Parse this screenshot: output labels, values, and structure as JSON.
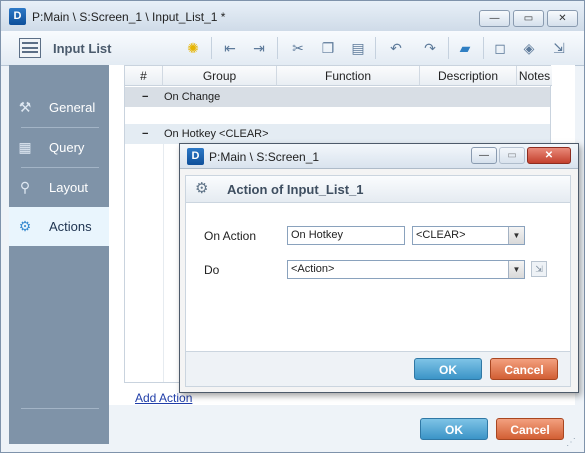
{
  "window": {
    "title": "P:Main \\ S:Screen_1 \\ Input_List_1 *",
    "logo": "D",
    "buttons": {
      "minimize": "—",
      "maximize": "▭",
      "close": "✕"
    }
  },
  "toolbar": {
    "title": "Input List",
    "icons": [
      "lightbulb-icon",
      "indent-left-icon",
      "indent-right-icon",
      "cut-icon",
      "copy-icon",
      "paste-icon",
      "undo-icon",
      "redo-icon",
      "comment-icon",
      "speech-icon",
      "tag-icon",
      "export-icon"
    ]
  },
  "sidebar": {
    "items": [
      {
        "label": "General",
        "icon": "general-icon"
      },
      {
        "label": "Query",
        "icon": "query-icon"
      },
      {
        "label": "Layout",
        "icon": "layout-icon"
      },
      {
        "label": "Actions",
        "icon": "actions-icon"
      }
    ],
    "active": "Actions"
  },
  "grid": {
    "columns": [
      "#",
      "Group",
      "Function",
      "Description",
      "Notes"
    ],
    "groups": [
      {
        "toggle": "−",
        "label": "On Change"
      },
      {
        "toggle": "−",
        "label": "On Hotkey <CLEAR>"
      }
    ]
  },
  "add_action_link": "Add Action",
  "main_buttons": {
    "ok": "OK",
    "cancel": "Cancel"
  },
  "dialog": {
    "title": "P:Main \\ S:Screen_1",
    "logo": "D",
    "header": "Action of Input_List_1",
    "on_action_label": "On Action",
    "on_action_value": "On Hotkey",
    "hotkey_value": "<CLEAR>",
    "do_label": "Do",
    "do_value": "<Action>",
    "ok": "OK",
    "cancel": "Cancel"
  },
  "colors": {
    "ok_button": "#4a9fd0",
    "cancel_button": "#d8683e",
    "sidebar": "#7f93a8",
    "sidebar_active": "#e9f5fd"
  }
}
